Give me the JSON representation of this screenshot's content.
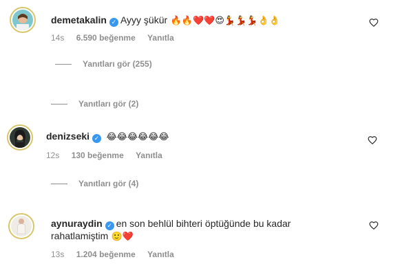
{
  "comments": [
    {
      "username": "demetakalin",
      "text": "Ayyy şükür",
      "emojis": "🔥🔥❤️❤️😍💃💃💃👌👌",
      "time": "14s",
      "likes": "6.590 beğenme",
      "reply": "Yanıtla"
    },
    {
      "username": "denizseki",
      "text": "",
      "emojis": "😂😂😂😂😂😂",
      "time": "12s",
      "likes": "130 beğenme",
      "reply": "Yanıtla"
    },
    {
      "username": "aynuraydin",
      "text_line1": "en son behlül bihteri öptüğünde bu kadar",
      "text_line2": "rahatlamiştim",
      "emojis": "🙂❤️",
      "time": "13s",
      "likes": "1.204 beğenme",
      "reply": "Yanıtla"
    }
  ],
  "reply_threads": [
    "Yanıtları gör (255)",
    "Yanıtları gör (2)",
    "Yanıtları gör (4)"
  ],
  "icons": {
    "verified": "verified-badge-icon",
    "like": "heart-outline-icon"
  },
  "colors": {
    "verified": "#3897f0",
    "meta_text": "#8e8e8e",
    "avatar_ring": "#d8c56a"
  }
}
